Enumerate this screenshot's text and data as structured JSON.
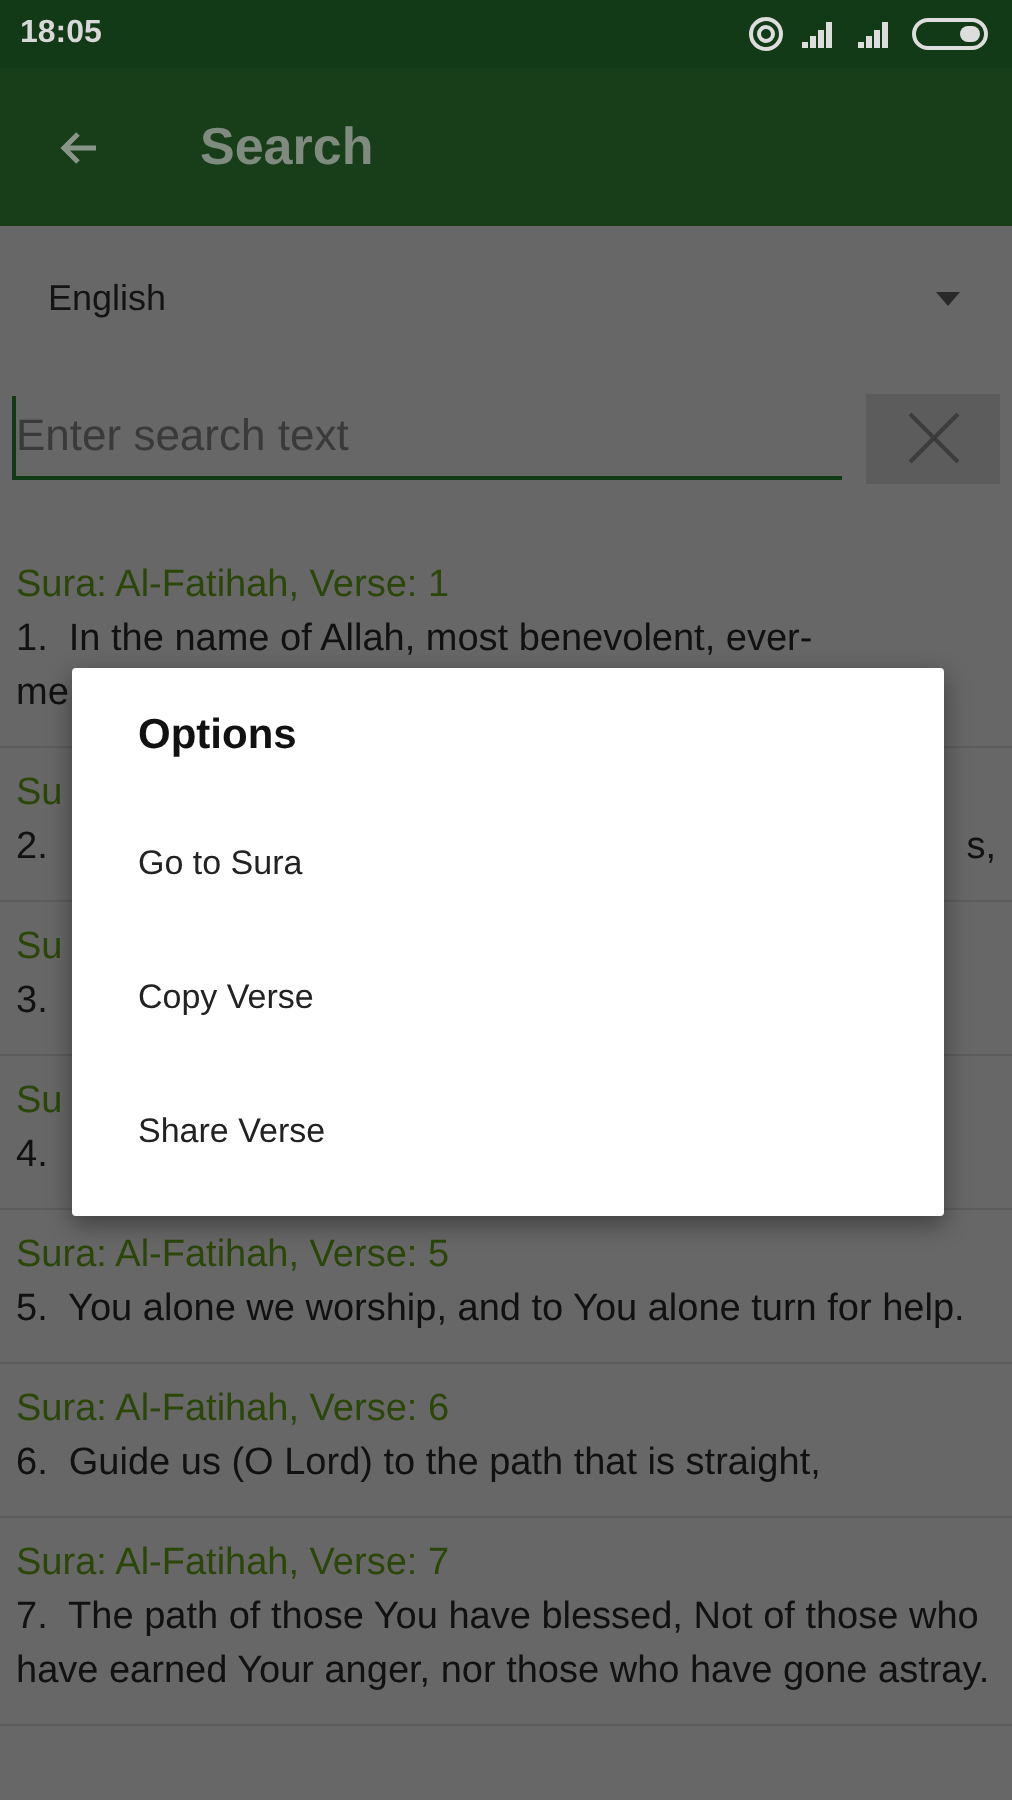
{
  "status_bar": {
    "time": "18:05"
  },
  "toolbar": {
    "title": "Search"
  },
  "language_select": {
    "value": "English"
  },
  "search": {
    "placeholder": "Enter search text"
  },
  "results": [
    {
      "kind": "full",
      "heading": "Sura: Al-Fatihah, Verse: 1",
      "lines": [
        "1.  In the name of Allah, most benevolent, ever-",
        "me"
      ]
    },
    {
      "kind": "covered",
      "heading": "Su",
      "lines": [
        "2."
      ],
      "tail": "s,"
    },
    {
      "kind": "covered",
      "heading": "Su",
      "lines": [
        "3."
      ]
    },
    {
      "kind": "covered",
      "heading": "Su",
      "lines": [
        "4."
      ]
    },
    {
      "kind": "full",
      "heading": "Sura: Al-Fatihah, Verse: 5",
      "text": "5.  You alone we worship, and to You alone turn for help."
    },
    {
      "kind": "full",
      "heading": "Sura: Al-Fatihah, Verse: 6",
      "text": "6.  Guide us (O Lord) to the path that is straight,"
    },
    {
      "kind": "full",
      "heading": "Sura: Al-Fatihah, Verse: 7",
      "text": "7.  The path of those You have blessed, Not of those who have earned Your anger, nor those who have gone astray."
    }
  ],
  "dialog": {
    "title": "Options",
    "items": [
      "Go to Sura",
      "Copy Verse",
      "Share Verse"
    ]
  }
}
